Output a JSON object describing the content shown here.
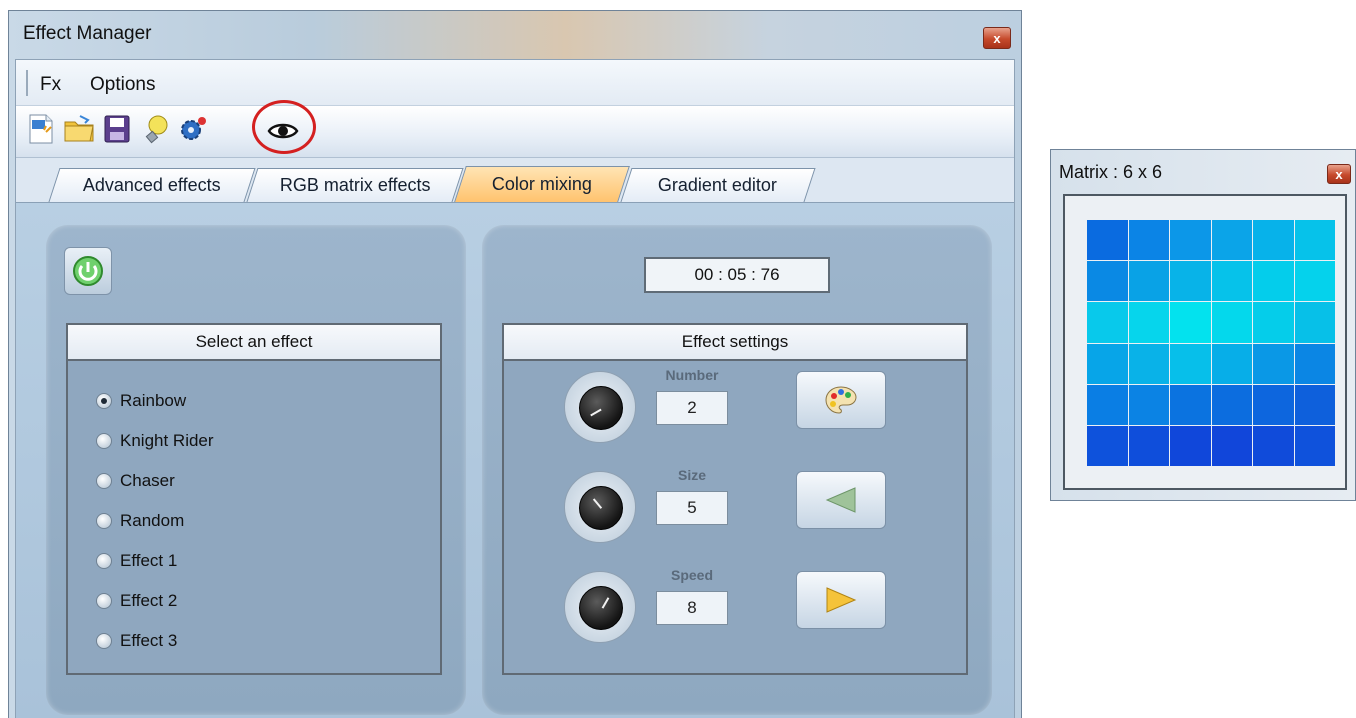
{
  "main_window": {
    "title": "Effect Manager",
    "close_label": "x"
  },
  "menubar": {
    "items": [
      "Fx",
      "Options"
    ]
  },
  "toolbar": {
    "icons": [
      "new-fx-icon",
      "open-folder-icon",
      "save-icon",
      "bulb-icon",
      "gear-icon",
      "eye-icon"
    ]
  },
  "tabs": {
    "items": [
      "Advanced effects",
      "RGB matrix effects",
      "Color mixing",
      "Gradient editor"
    ],
    "active": "Color mixing"
  },
  "left_panel": {
    "header": "Select an effect",
    "effects": [
      "Rainbow",
      "Knight Rider",
      "Chaser",
      "Random",
      "Effect 1",
      "Effect 2",
      "Effect 3"
    ],
    "selected": "Rainbow"
  },
  "right_panel": {
    "timer": "00 : 05 : 76",
    "header": "Effect settings",
    "params": [
      {
        "label": "Number",
        "value": "2"
      },
      {
        "label": "Size",
        "value": "5"
      },
      {
        "label": "Speed",
        "value": "8"
      }
    ],
    "buttons": [
      "palette-icon",
      "play-back-icon",
      "play-icon"
    ]
  },
  "matrix_window": {
    "title": "Matrix : 6 x 6",
    "close_label": "x",
    "colors": [
      [
        "#0a6be0",
        "#0b84e6",
        "#0c97e8",
        "#0ba4e8",
        "#07b2ea",
        "#06c2ea"
      ],
      [
        "#0a89e4",
        "#09a2e6",
        "#08b3e8",
        "#06c2ea",
        "#04cdeb",
        "#05d2ec"
      ],
      [
        "#08c9eb",
        "#06d5ec",
        "#03e2ee",
        "#04d8ec",
        "#05cdea",
        "#07c0e8"
      ],
      [
        "#07a5e8",
        "#09b2e8",
        "#07bfea",
        "#07aee8",
        "#0a98e6",
        "#0b86e4"
      ],
      [
        "#0a7ee4",
        "#0b83e4",
        "#0b73e0",
        "#0c6ddf",
        "#0d66de",
        "#0e60dc"
      ],
      [
        "#0e52dc",
        "#0f4edb",
        "#1047da",
        "#1146da",
        "#104bda",
        "#0f52dc"
      ]
    ]
  }
}
